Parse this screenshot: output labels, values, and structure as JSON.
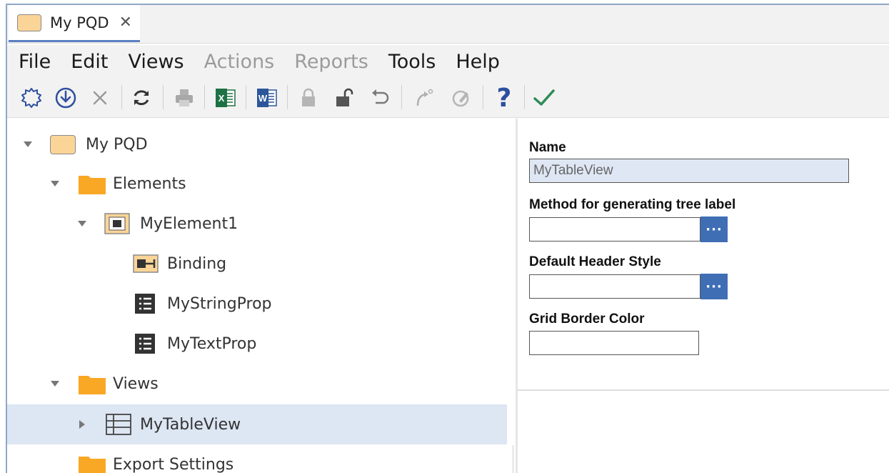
{
  "tab": {
    "label": "My PQD",
    "close": "✕"
  },
  "menu": {
    "file": "File",
    "edit": "Edit",
    "views": "Views",
    "actions": "Actions",
    "reports": "Reports",
    "tools": "Tools",
    "help": "Help"
  },
  "toolbar": {
    "icons": [
      "new-icon",
      "download-icon",
      "delete-icon",
      "refresh-icon",
      "print-icon",
      "excel-icon",
      "word-icon",
      "lock-icon",
      "unlock-icon",
      "undo-icon",
      "redo-icon",
      "edit-badge-icon",
      "help-icon",
      "check-icon"
    ],
    "help_glyph": "?",
    "check_glyph": "✓",
    "excel_glyph": "X",
    "word_glyph": "W"
  },
  "tree": {
    "root": "My PQD",
    "elements": "Elements",
    "element1": "MyElement1",
    "binding": "Binding",
    "string_prop": "MyStringProp",
    "text_prop": "MyTextProp",
    "views": "Views",
    "table_view": "MyTableView",
    "export_settings": "Export Settings"
  },
  "props": {
    "name_label": "Name",
    "name_value": "MyTableView",
    "tree_label_label": "Method for generating tree label",
    "tree_label_value": "",
    "header_style_label": "Default Header Style",
    "header_style_value": "",
    "grid_border_label": "Grid Border Color",
    "grid_border_value": "",
    "ellipsis": "···"
  },
  "colors": {
    "accent": "#3f6eb5",
    "folder": "#f9a825",
    "selection": "#dde6f3",
    "check": "#2e8b57",
    "help": "#2d4fa0"
  }
}
